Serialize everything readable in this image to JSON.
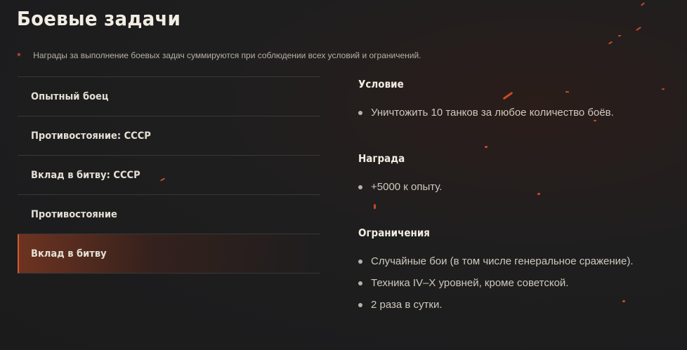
{
  "page": {
    "title": "Боевые задачи",
    "note": "Награды за выполнение боевых задач суммируются при соблюдении всех условий и ограничений.",
    "note_marker": "*"
  },
  "tabs": [
    {
      "label": "Опытный боец",
      "active": false
    },
    {
      "label": "Противостояние: СССР",
      "active": false
    },
    {
      "label": "Вклад в битву: СССР",
      "active": false
    },
    {
      "label": "Противостояние",
      "active": false
    },
    {
      "label": "Вклад в битву",
      "active": true
    }
  ],
  "details": {
    "condition": {
      "title": "Условие",
      "items": [
        "Уничтожить 10 танков за любое количество боёв."
      ]
    },
    "reward": {
      "title": "Награда",
      "items": [
        "+5000 к опыту."
      ]
    },
    "restrictions": {
      "title": "Ограничения",
      "items": [
        "Случайные бои (в том числе генеральное сражение).",
        "Техника IV–X уровней, кроме советской.",
        "2 раза в сутки."
      ]
    }
  },
  "colors": {
    "background": "#1e1e1f",
    "accent": "#d9582f",
    "title": "#f2ede3",
    "text": "#cfc9bd"
  }
}
